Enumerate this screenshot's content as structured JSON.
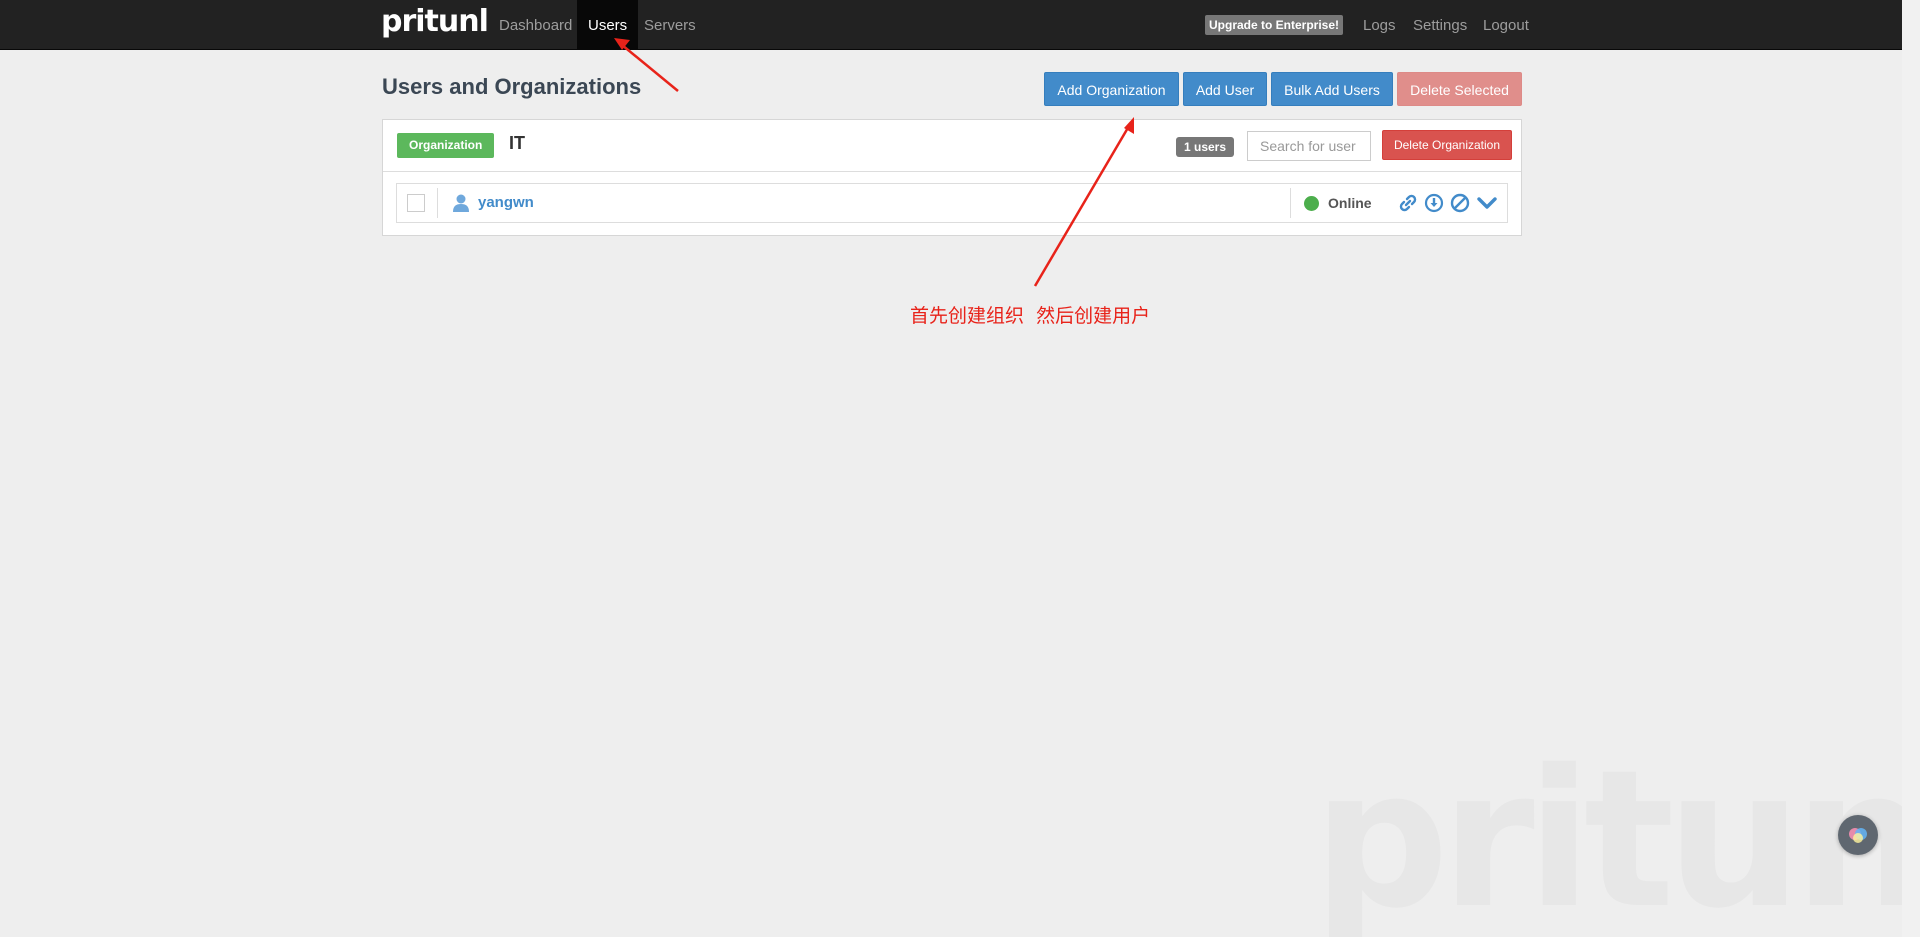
{
  "navbar": {
    "brand": "pritunl",
    "links": [
      {
        "label": "Dashboard",
        "active": false
      },
      {
        "label": "Users",
        "active": true
      },
      {
        "label": "Servers",
        "active": false
      }
    ],
    "upgrade_label": "Upgrade to Enterprise!",
    "right_links": [
      {
        "label": "Logs"
      },
      {
        "label": "Settings"
      },
      {
        "label": "Logout"
      }
    ]
  },
  "header": {
    "title": "Users and Organizations",
    "buttons": {
      "add_org": "Add Organization",
      "add_user": "Add User",
      "bulk_add": "Bulk Add Users",
      "delete_selected": "Delete Selected"
    }
  },
  "organization": {
    "label": "Organization",
    "name": "IT",
    "user_count": "1 users",
    "search_placeholder": "Search for user",
    "delete_label": "Delete Organization",
    "users": [
      {
        "name": "yangwn",
        "status": "Online",
        "status_color": "#4cae4c"
      }
    ]
  },
  "annotation": {
    "text": "首先创建组织  然后创建用户",
    "color": "#e8231a"
  },
  "watermark": "pritunl",
  "colors": {
    "primary": "#428bca",
    "danger": "#d9534f",
    "success": "#5cb85c",
    "navbar": "#222222"
  }
}
